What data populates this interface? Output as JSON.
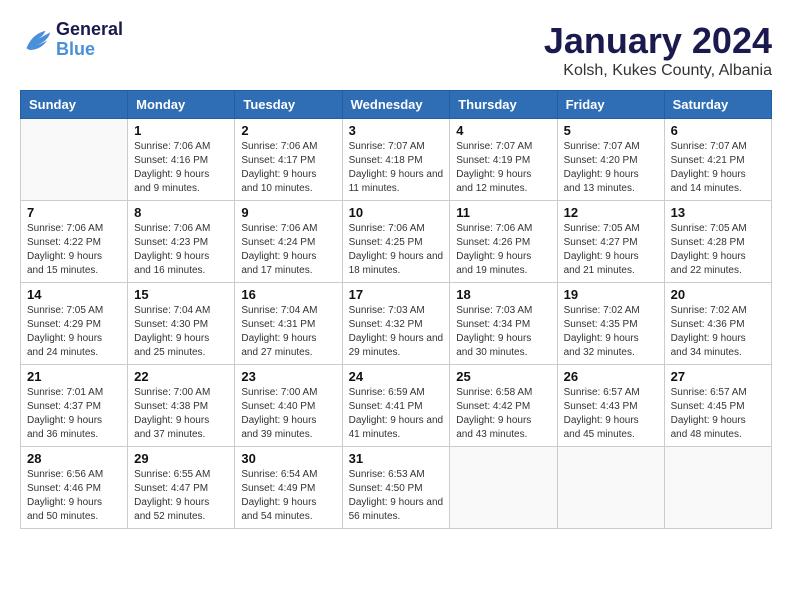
{
  "logo": {
    "line1": "General",
    "line2": "Blue"
  },
  "title": "January 2024",
  "subtitle": "Kolsh, Kukes County, Albania",
  "weekdays": [
    "Sunday",
    "Monday",
    "Tuesday",
    "Wednesday",
    "Thursday",
    "Friday",
    "Saturday"
  ],
  "weeks": [
    [
      {
        "day": null
      },
      {
        "day": 1,
        "sunrise": "Sunrise: 7:06 AM",
        "sunset": "Sunset: 4:16 PM",
        "daylight": "Daylight: 9 hours and 9 minutes."
      },
      {
        "day": 2,
        "sunrise": "Sunrise: 7:06 AM",
        "sunset": "Sunset: 4:17 PM",
        "daylight": "Daylight: 9 hours and 10 minutes."
      },
      {
        "day": 3,
        "sunrise": "Sunrise: 7:07 AM",
        "sunset": "Sunset: 4:18 PM",
        "daylight": "Daylight: 9 hours and 11 minutes."
      },
      {
        "day": 4,
        "sunrise": "Sunrise: 7:07 AM",
        "sunset": "Sunset: 4:19 PM",
        "daylight": "Daylight: 9 hours and 12 minutes."
      },
      {
        "day": 5,
        "sunrise": "Sunrise: 7:07 AM",
        "sunset": "Sunset: 4:20 PM",
        "daylight": "Daylight: 9 hours and 13 minutes."
      },
      {
        "day": 6,
        "sunrise": "Sunrise: 7:07 AM",
        "sunset": "Sunset: 4:21 PM",
        "daylight": "Daylight: 9 hours and 14 minutes."
      }
    ],
    [
      {
        "day": 7,
        "sunrise": "Sunrise: 7:06 AM",
        "sunset": "Sunset: 4:22 PM",
        "daylight": "Daylight: 9 hours and 15 minutes."
      },
      {
        "day": 8,
        "sunrise": "Sunrise: 7:06 AM",
        "sunset": "Sunset: 4:23 PM",
        "daylight": "Daylight: 9 hours and 16 minutes."
      },
      {
        "day": 9,
        "sunrise": "Sunrise: 7:06 AM",
        "sunset": "Sunset: 4:24 PM",
        "daylight": "Daylight: 9 hours and 17 minutes."
      },
      {
        "day": 10,
        "sunrise": "Sunrise: 7:06 AM",
        "sunset": "Sunset: 4:25 PM",
        "daylight": "Daylight: 9 hours and 18 minutes."
      },
      {
        "day": 11,
        "sunrise": "Sunrise: 7:06 AM",
        "sunset": "Sunset: 4:26 PM",
        "daylight": "Daylight: 9 hours and 19 minutes."
      },
      {
        "day": 12,
        "sunrise": "Sunrise: 7:05 AM",
        "sunset": "Sunset: 4:27 PM",
        "daylight": "Daylight: 9 hours and 21 minutes."
      },
      {
        "day": 13,
        "sunrise": "Sunrise: 7:05 AM",
        "sunset": "Sunset: 4:28 PM",
        "daylight": "Daylight: 9 hours and 22 minutes."
      }
    ],
    [
      {
        "day": 14,
        "sunrise": "Sunrise: 7:05 AM",
        "sunset": "Sunset: 4:29 PM",
        "daylight": "Daylight: 9 hours and 24 minutes."
      },
      {
        "day": 15,
        "sunrise": "Sunrise: 7:04 AM",
        "sunset": "Sunset: 4:30 PM",
        "daylight": "Daylight: 9 hours and 25 minutes."
      },
      {
        "day": 16,
        "sunrise": "Sunrise: 7:04 AM",
        "sunset": "Sunset: 4:31 PM",
        "daylight": "Daylight: 9 hours and 27 minutes."
      },
      {
        "day": 17,
        "sunrise": "Sunrise: 7:03 AM",
        "sunset": "Sunset: 4:32 PM",
        "daylight": "Daylight: 9 hours and 29 minutes."
      },
      {
        "day": 18,
        "sunrise": "Sunrise: 7:03 AM",
        "sunset": "Sunset: 4:34 PM",
        "daylight": "Daylight: 9 hours and 30 minutes."
      },
      {
        "day": 19,
        "sunrise": "Sunrise: 7:02 AM",
        "sunset": "Sunset: 4:35 PM",
        "daylight": "Daylight: 9 hours and 32 minutes."
      },
      {
        "day": 20,
        "sunrise": "Sunrise: 7:02 AM",
        "sunset": "Sunset: 4:36 PM",
        "daylight": "Daylight: 9 hours and 34 minutes."
      }
    ],
    [
      {
        "day": 21,
        "sunrise": "Sunrise: 7:01 AM",
        "sunset": "Sunset: 4:37 PM",
        "daylight": "Daylight: 9 hours and 36 minutes."
      },
      {
        "day": 22,
        "sunrise": "Sunrise: 7:00 AM",
        "sunset": "Sunset: 4:38 PM",
        "daylight": "Daylight: 9 hours and 37 minutes."
      },
      {
        "day": 23,
        "sunrise": "Sunrise: 7:00 AM",
        "sunset": "Sunset: 4:40 PM",
        "daylight": "Daylight: 9 hours and 39 minutes."
      },
      {
        "day": 24,
        "sunrise": "Sunrise: 6:59 AM",
        "sunset": "Sunset: 4:41 PM",
        "daylight": "Daylight: 9 hours and 41 minutes."
      },
      {
        "day": 25,
        "sunrise": "Sunrise: 6:58 AM",
        "sunset": "Sunset: 4:42 PM",
        "daylight": "Daylight: 9 hours and 43 minutes."
      },
      {
        "day": 26,
        "sunrise": "Sunrise: 6:57 AM",
        "sunset": "Sunset: 4:43 PM",
        "daylight": "Daylight: 9 hours and 45 minutes."
      },
      {
        "day": 27,
        "sunrise": "Sunrise: 6:57 AM",
        "sunset": "Sunset: 4:45 PM",
        "daylight": "Daylight: 9 hours and 48 minutes."
      }
    ],
    [
      {
        "day": 28,
        "sunrise": "Sunrise: 6:56 AM",
        "sunset": "Sunset: 4:46 PM",
        "daylight": "Daylight: 9 hours and 50 minutes."
      },
      {
        "day": 29,
        "sunrise": "Sunrise: 6:55 AM",
        "sunset": "Sunset: 4:47 PM",
        "daylight": "Daylight: 9 hours and 52 minutes."
      },
      {
        "day": 30,
        "sunrise": "Sunrise: 6:54 AM",
        "sunset": "Sunset: 4:49 PM",
        "daylight": "Daylight: 9 hours and 54 minutes."
      },
      {
        "day": 31,
        "sunrise": "Sunrise: 6:53 AM",
        "sunset": "Sunset: 4:50 PM",
        "daylight": "Daylight: 9 hours and 56 minutes."
      },
      {
        "day": null
      },
      {
        "day": null
      },
      {
        "day": null
      }
    ]
  ]
}
